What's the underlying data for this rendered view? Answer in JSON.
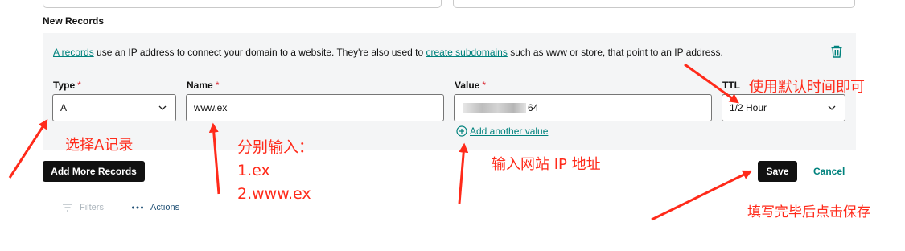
{
  "section_title": "New Records",
  "info": {
    "link_a_records": "A records",
    "text_1": " use an IP address to connect your domain to a website. They're also used to ",
    "link_create_subdomains": "create subdomains",
    "text_2": " such as www or store, that point to an IP address."
  },
  "delete_icon": "trash-icon",
  "fields": {
    "type": {
      "label": "Type",
      "required": "*",
      "value": "A"
    },
    "name": {
      "label": "Name",
      "required": "*",
      "value": "www.ex"
    },
    "value": {
      "label": "Value",
      "required": "*",
      "value_suffix": "64"
    },
    "ttl": {
      "label": "TTL",
      "value": "1/2 Hour"
    }
  },
  "add_another_value": "Add another value",
  "buttons": {
    "add_more_records": "Add More Records",
    "save": "Save",
    "cancel": "Cancel"
  },
  "toolbar": {
    "filters": "Filters",
    "actions": "Actions"
  },
  "annotations": {
    "ttl_note": "使用默认时间即可",
    "type_note": "选择A记录",
    "name_note_title": "分别输入：",
    "name_note_1": "1.ex",
    "name_note_2": "2.www.ex",
    "value_note": "输入网站 IP 地址",
    "save_note": "填写完毕后点击保存"
  },
  "colors": {
    "annotation": "#ff2a1a",
    "link": "#00827d",
    "required": "#d9232e",
    "button_dark": "#111111",
    "panel_bg": "#f4f5f6"
  }
}
